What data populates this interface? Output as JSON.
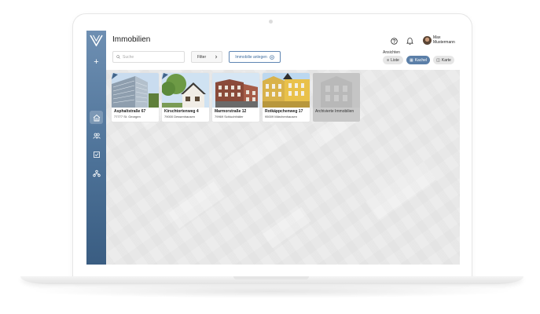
{
  "app": {
    "page_title": "Immobilien",
    "brand_color": "#4d7298",
    "accent_color": "#5f86b3"
  },
  "sidebar": {
    "logo_icon": "v-logo-icon",
    "add_icon": "+",
    "items": [
      {
        "icon": "home-icon",
        "active": true
      },
      {
        "icon": "people-icon",
        "active": false
      },
      {
        "icon": "checklist-icon",
        "active": false
      },
      {
        "icon": "network-icon",
        "active": false
      }
    ]
  },
  "toolbar": {
    "search_placeholder": "Suche",
    "filter_label": "Filter",
    "create_label": "Immobilie anlegen",
    "views_label": "Ansichten",
    "views": [
      {
        "label": "Liste",
        "active": false
      },
      {
        "label": "Kachel",
        "active": true
      },
      {
        "label": "Karte",
        "active": false
      }
    ]
  },
  "user": {
    "first_name": "Max",
    "last_name": "Mustermann"
  },
  "properties": [
    {
      "street": "Asphaltstraße 67",
      "city": "77777 St. Georgen"
    },
    {
      "street": "Kirschtortenweg 4",
      "city": "79000 Dessenhausen"
    },
    {
      "street": "Marmorstraße 12",
      "city": "79969 Schluchthäler"
    },
    {
      "street": "Rotkäppchenweg 17",
      "city": "95009 Märchenhausen"
    }
  ],
  "archive": {
    "label": "Archivierte Immobilien"
  }
}
